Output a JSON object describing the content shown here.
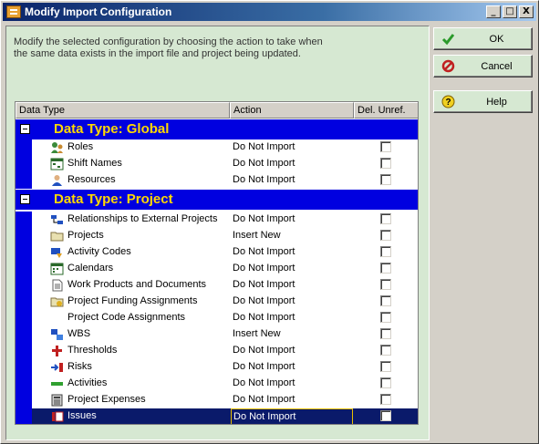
{
  "window": {
    "title": "Modify Import Configuration",
    "minimize": "_",
    "maximize": "□",
    "close": "X"
  },
  "instructions": "Modify the selected configuration by choosing the action to take when the same data exists in the import file and project being updated.",
  "buttons": {
    "ok": "OK",
    "cancel": "Cancel",
    "help": "Help"
  },
  "grid": {
    "columns": {
      "data_type": "Data Type",
      "action": "Action",
      "del_unref": "Del. Unref."
    },
    "groups": [
      {
        "title": "Data Type: Global",
        "rows": [
          {
            "label": "Roles",
            "action": "Do Not Import",
            "icon": "roles-icon"
          },
          {
            "label": "Shift Names",
            "action": "Do Not Import",
            "icon": "shift-names-icon"
          },
          {
            "label": "Resources",
            "action": "Do Not Import",
            "icon": "resources-icon"
          }
        ]
      },
      {
        "title": "Data Type: Project",
        "rows": [
          {
            "label": "Relationships to External Projects",
            "action": "Do Not Import",
            "icon": "relationships-icon"
          },
          {
            "label": "Projects",
            "action": "Insert New",
            "icon": "folder-icon"
          },
          {
            "label": "Activity Codes",
            "action": "Do Not Import",
            "icon": "activity-codes-icon"
          },
          {
            "label": "Calendars",
            "action": "Do Not Import",
            "icon": "calendar-icon"
          },
          {
            "label": "Work Products and Documents",
            "action": "Do Not Import",
            "icon": "document-icon"
          },
          {
            "label": "Project Funding Assignments",
            "action": "Do Not Import",
            "icon": "funding-icon"
          },
          {
            "label": "Project Code Assignments",
            "action": "Do Not Import",
            "icon": ""
          },
          {
            "label": "WBS",
            "action": "Insert New",
            "icon": "wbs-icon"
          },
          {
            "label": "Thresholds",
            "action": "Do Not Import",
            "icon": "thresholds-icon"
          },
          {
            "label": "Risks",
            "action": "Do Not Import",
            "icon": "risks-icon"
          },
          {
            "label": "Activities",
            "action": "Do Not Import",
            "icon": "activities-icon"
          },
          {
            "label": "Project Expenses",
            "action": "Do Not Import",
            "icon": "expenses-icon"
          },
          {
            "label": "Issues",
            "action": "Do Not Import",
            "icon": "issues-icon",
            "selected": true
          }
        ]
      }
    ]
  }
}
